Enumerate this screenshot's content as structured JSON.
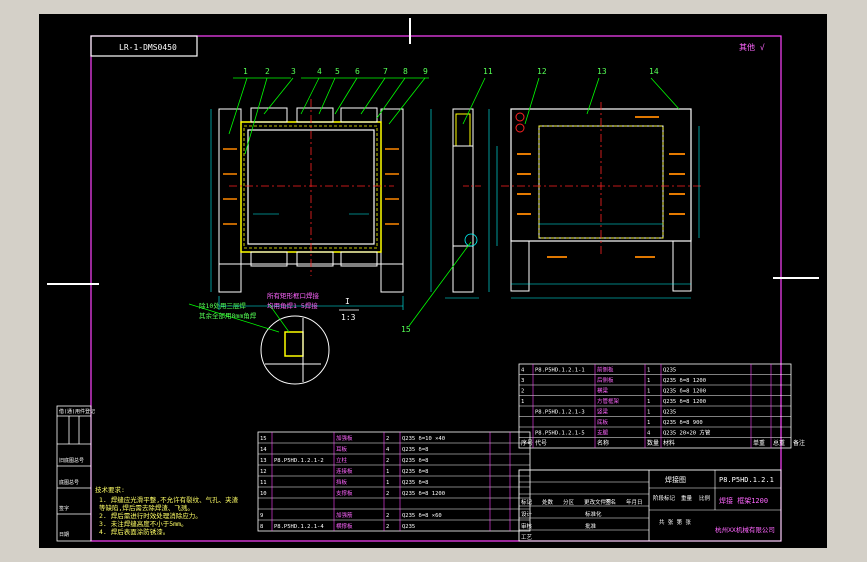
{
  "drawing": {
    "code_box": "LR-1-DMS0450",
    "scale_note": "其他 √",
    "detail_label": "I",
    "detail_scale": "1:3",
    "weld_note_1": "除10处用三层焊",
    "weld_note_2": "其余全部用8mm角焊",
    "weld_note_3": "所有矩形框口焊接",
    "weld_note_4": "均用角焊1 5焊接",
    "balloons": [
      "1",
      "2",
      "3",
      "4",
      "5",
      "6",
      "7",
      "8",
      "9",
      "11",
      "12",
      "13",
      "14",
      "15"
    ],
    "tech_req_title": "技术要求:",
    "tech_req_lines": [
      "1. 焊缝应光滑平整,不允许有裂纹、气孔、夹渣",
      "   等缺陷,焊后需去除焊渣、飞溅。",
      "2. 焊后需进行时效处理消除应力。",
      "3. 未注焊缝高度不小于5mm。",
      "4. 焊后表面涂防锈漆。"
    ],
    "left_strip_labels": [
      "借(通)用件登记",
      "旧底图总号",
      "底图总号",
      "签字",
      "日期"
    ],
    "bom_upper": [
      [
        "4",
        "P8.P5HD.1.2.1-1",
        "前侧板",
        "1",
        "Q235",
        "",
        ""
      ],
      [
        "3",
        "",
        "后侧板",
        "1",
        "Q235 δ=8 1200",
        "",
        ""
      ],
      [
        "2",
        "",
        "横梁",
        "1",
        "Q235 δ=8 1200",
        "",
        ""
      ],
      [
        "1",
        "",
        "方管框架",
        "1",
        "Q235 δ=8 1200",
        "",
        ""
      ],
      [
        "",
        "P8.P5HD.1.2.1-3",
        "竖梁",
        "1",
        "Q235",
        "",
        ""
      ],
      [
        "",
        "",
        "底板",
        "1",
        "Q235 δ=8 900",
        "",
        ""
      ],
      [
        "",
        "P8.P5HD.1.2.1-5",
        "支腿",
        "4",
        "Q235 20×20 方管",
        "",
        ""
      ]
    ],
    "bom_upper_header": [
      "序号",
      "代号",
      "名称",
      "数量",
      "材料",
      "单重",
      "总重",
      "备注"
    ],
    "bom_lower": [
      [
        "15",
        "",
        "加强板",
        "2",
        "Q235 δ=10 ×40",
        "",
        ""
      ],
      [
        "14",
        "",
        "耳板",
        "4",
        "Q235 δ=8",
        "",
        ""
      ],
      [
        "13",
        "P8.P5HD.1.2.1-2",
        "立柱",
        "2",
        "Q235 δ=8",
        "",
        ""
      ],
      [
        "12",
        "",
        "连接板",
        "1",
        "Q235 δ=8",
        "",
        ""
      ],
      [
        "11",
        "",
        "挡板",
        "1",
        "Q235 δ=8",
        "",
        ""
      ],
      [
        "10",
        "",
        "支撑板",
        "2",
        "Q235 δ=8 1200",
        "",
        ""
      ],
      [
        "",
        "",
        "",
        "",
        "",
        "",
        ""
      ],
      [
        "9",
        "",
        "加强筋",
        "2",
        "Q235 δ=8 ×60",
        "",
        ""
      ],
      [
        "8",
        "P8.P5HD.1.2.1-4",
        "横撑板",
        "2",
        "Q235",
        "",
        ""
      ]
    ],
    "title_block": {
      "assembly_name": "焊接图",
      "drawing_no": "P8.P5HD.1.2.1",
      "part_name": "焊接 框架1200",
      "company": "杭州XX机械有限公司",
      "row_labels": [
        "标记",
        "处数",
        "分区",
        "更改文件号",
        "签名",
        "年月日"
      ],
      "designer_label": "设计",
      "checker_label": "审核",
      "process_label": "工艺",
      "approve_label": "批准",
      "standard_label": "标准化",
      "stage_label": "阶段标记",
      "weight_label": "重量",
      "scale_label": "比例",
      "sheet_label": "共  张 第  张"
    }
  },
  "colors": {
    "background": "#000000",
    "frame": "#ff00ff",
    "part": "#ffffff",
    "centerline": "#ff2222",
    "hidden": "#ffff00",
    "dimension": "#00ffff",
    "leader": "#00ff00",
    "slot": "#ff8800",
    "screen_bg": "#d4d0c8"
  }
}
